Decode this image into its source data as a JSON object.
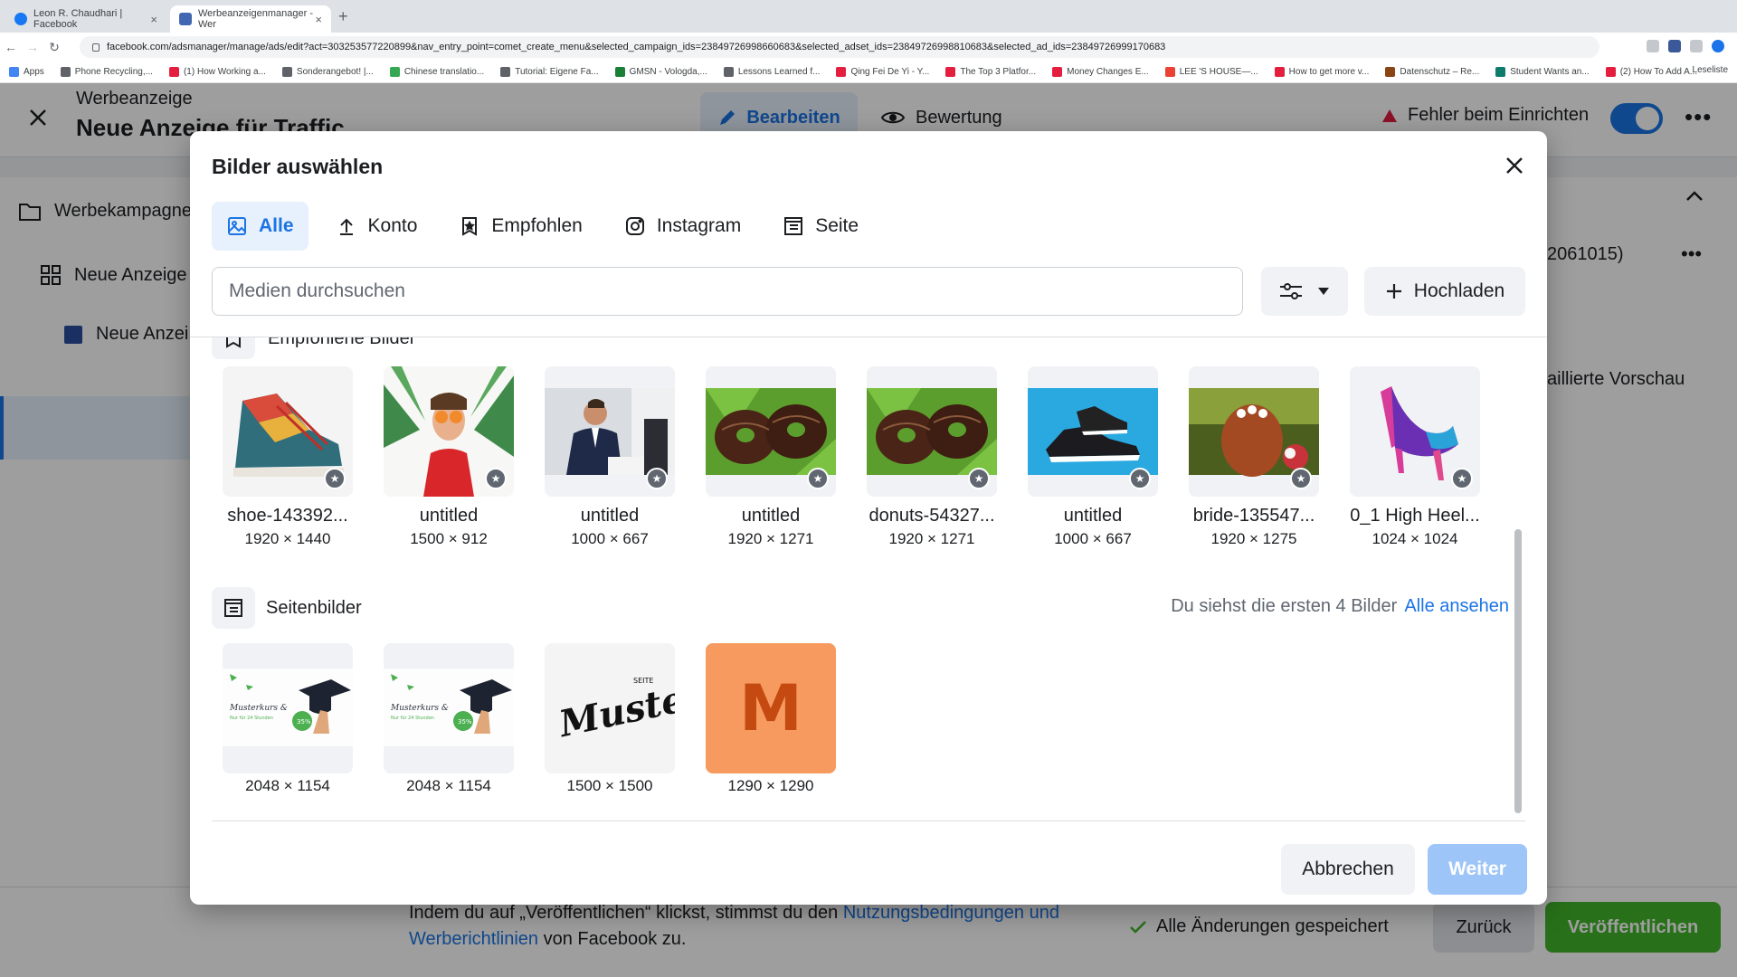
{
  "browser": {
    "tabs": [
      {
        "title": "Leon R. Chaudhari | Facebook"
      },
      {
        "title": "Werbeanzeigenmanager - Wer"
      }
    ],
    "url": "facebook.com/adsmanager/manage/ads/edit?act=303253577220899&nav_entry_point=comet_create_menu&selected_campaign_ids=23849726998660683&selected_adset_ids=23849726998810683&selected_ad_ids=23849726999170683",
    "bookmarks": [
      "Apps",
      "Phone Recycling,...",
      "(1) How Working a...",
      "Sonderangebot! |...",
      "Chinese translatio...",
      "Tutorial: Eigene Fa...",
      "GMSN - Vologda,...",
      "Lessons Learned f...",
      "Qing Fei De Yi - Y...",
      "The Top 3 Platfor...",
      "Money Changes E...",
      "LEE 'S HOUSE—...",
      "How to get more v...",
      "Datenschutz – Re...",
      "Student Wants an...",
      "(2) How To Add A..."
    ],
    "reading_list": "Leseliste"
  },
  "app": {
    "title_small": "Werbeanzeige",
    "title_large": "Neue Anzeige für Traffic",
    "edit_tab": "Bearbeiten",
    "review_tab": "Bewertung",
    "error_text": "Fehler beim Einrichten",
    "nav": {
      "campaign": "Werbekampagne",
      "adset": "Neue Anzeige",
      "ad": "Neue Anzei"
    },
    "right": {
      "id_text": "2061015)",
      "preview": "aillierte Vorschau"
    },
    "footer": {
      "text_before": "Indem du auf „Veröffentlichen“ klickst, stimmst du den ",
      "link1": "Nutzungsbedingungen und Werberichtlinien",
      "text_after": " von Facebook zu.",
      "saved": "Alle Änderungen gespeichert",
      "back": "Zurück",
      "publish": "Veröffentlichen"
    }
  },
  "modal": {
    "title": "Bilder auswählen",
    "tabs": [
      {
        "label": "Alle",
        "icon": "image-icon"
      },
      {
        "label": "Konto",
        "icon": "upload-icon"
      },
      {
        "label": "Empfohlen",
        "icon": "badge-icon"
      },
      {
        "label": "Instagram",
        "icon": "instagram-icon"
      },
      {
        "label": "Seite",
        "icon": "page-icon"
      }
    ],
    "search_placeholder": "Medien durchsuchen",
    "upload": "Hochladen",
    "section1_title": "Empfohlene Bilder",
    "recommended": [
      {
        "name": "shoe-143392...",
        "dims": "1920 × 1440",
        "thumb": "shoe"
      },
      {
        "name": "untitled",
        "dims": "1500 × 912",
        "thumb": "woman"
      },
      {
        "name": "untitled",
        "dims": "1000 × 667",
        "thumb": "business"
      },
      {
        "name": "untitled",
        "dims": "1920 × 1271",
        "thumb": "donuts"
      },
      {
        "name": "donuts-54327...",
        "dims": "1920 × 1271",
        "thumb": "donuts"
      },
      {
        "name": "untitled",
        "dims": "1000 × 667",
        "thumb": "sneaker"
      },
      {
        "name": "bride-135547...",
        "dims": "1920 × 1275",
        "thumb": "bride"
      },
      {
        "name": "0_1 High Heel...",
        "dims": "1024 × 1024",
        "thumb": "heel"
      }
    ],
    "section2_title": "Seitenbilder",
    "section2_info": "Du siehst die ersten 4 Bilder",
    "section2_link": "Alle ansehen",
    "page_images": [
      {
        "dims": "2048 × 1154",
        "thumb": "grad"
      },
      {
        "dims": "2048 × 1154",
        "thumb": "grad"
      },
      {
        "dims": "1500 × 1500",
        "thumb": "muster",
        "text": "Muster",
        "subtext": "SEITE"
      },
      {
        "dims": "1290 × 1290",
        "thumb": "letter",
        "text": "M"
      }
    ],
    "cancel": "Abbrechen",
    "next": "Weiter"
  },
  "colors": {
    "accent": "#1b74e4",
    "publish": "#42b72a",
    "next_disabled": "#9ec5f8",
    "m_tile": "#f79a5f",
    "m_letter": "#c44a12"
  }
}
